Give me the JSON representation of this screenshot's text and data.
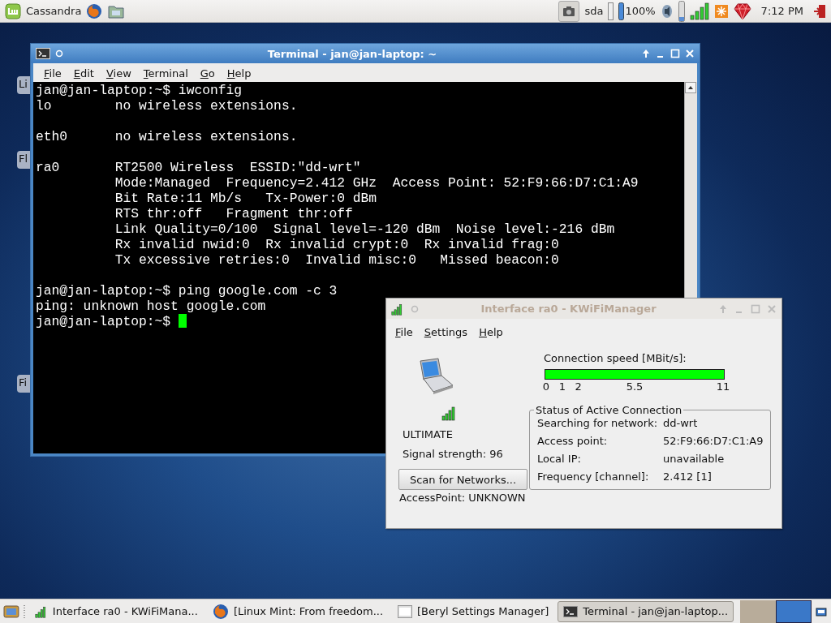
{
  "top_panel": {
    "menu_label": "Cassandra",
    "drive_label": "sda",
    "battery": "100%",
    "clock": "7:12 PM"
  },
  "desktop_icons": [
    {
      "label": "Li"
    },
    {
      "label": "Fl"
    },
    {
      "label": "Fi"
    }
  ],
  "terminal": {
    "title": "Terminal - jan@jan-laptop: ~",
    "menu": [
      "File",
      "Edit",
      "View",
      "Terminal",
      "Go",
      "Help"
    ],
    "blocks": [
      [
        "jan@jan-laptop:~$ iwconfig",
        "lo        no wireless extensions."
      ],
      [
        "eth0      no wireless extensions."
      ],
      [
        "ra0       RT2500 Wireless  ESSID:\"dd-wrt\"",
        "          Mode:Managed  Frequency=2.412 GHz  Access Point: 52:F9:66:D7:C1:A9",
        "          Bit Rate:11 Mb/s   Tx-Power:0 dBm",
        "          RTS thr:off   Fragment thr:off",
        "          Link Quality=0/100  Signal level=-120 dBm  Noise level:-216 dBm",
        "          Rx invalid nwid:0  Rx invalid crypt:0  Rx invalid frag:0",
        "          Tx excessive retries:0  Invalid misc:0   Missed beacon:0"
      ],
      [
        "jan@jan-laptop:~$ ping google.com -c 3",
        "ping: unknown host google.com",
        "jan@jan-laptop:~$"
      ]
    ],
    "cursor_visible": true
  },
  "wifi_manager": {
    "title": "Interface ra0 - KWiFiManager",
    "menu": [
      "File",
      "Settings",
      "Help"
    ],
    "quality": "ULTIMATE",
    "signal_strength": "Signal strength: 96",
    "scan_button": "Scan for Networks...",
    "access_point_status": "AccessPoint: UNKNOWN",
    "speed": {
      "label": "Connection speed [MBit/s]:",
      "level": 1,
      "scale": [
        "0",
        "1",
        "2",
        "5.5",
        "11"
      ]
    },
    "status": {
      "title": "Status of Active Connection",
      "rows": [
        {
          "label": "Searching for network:",
          "value": "dd-wrt"
        },
        {
          "label": "Access point:",
          "value": "52:F9:66:D7:C1:A9"
        },
        {
          "label": "Local IP:",
          "value": "unavailable"
        },
        {
          "label": "Frequency [channel]:",
          "value": "2.412 [1]"
        }
      ]
    }
  },
  "taskbar": {
    "items": [
      {
        "kind": "signal",
        "label": "Interface ra0 - KWiFiMana...",
        "selected": false
      },
      {
        "kind": "browser",
        "label": "[Linux Mint: From freedom...",
        "selected": false
      },
      {
        "kind": "settings",
        "label": "[Beryl Settings Manager]",
        "selected": false
      },
      {
        "kind": "terminal",
        "label": "Terminal - jan@jan-laptop...",
        "selected": true
      }
    ],
    "workspaces": [
      {
        "selected": false
      },
      {
        "selected": true
      }
    ]
  }
}
